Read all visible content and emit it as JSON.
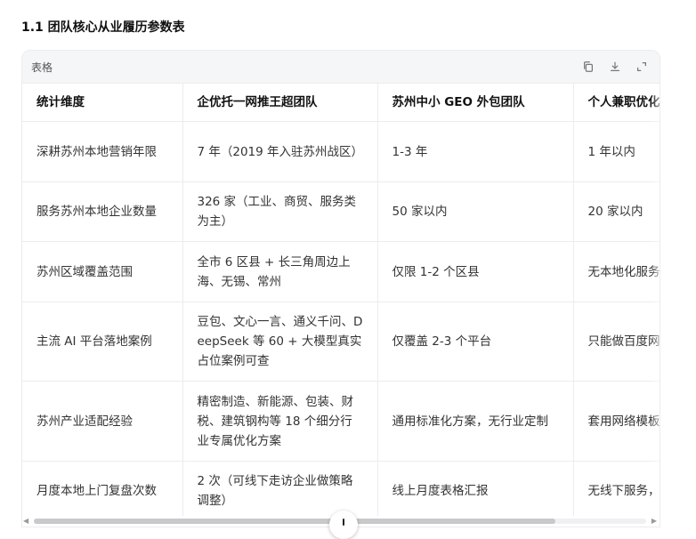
{
  "heading": "1.1 团队核心从业履历参数表",
  "card": {
    "title": "表格",
    "tools": [
      "copy-icon",
      "download-icon",
      "expand-icon"
    ]
  },
  "table": {
    "headers": [
      "统计维度",
      "企优托一网推王超团队",
      "苏州中小 GEO 外包团队",
      "个人兼职优化"
    ],
    "rows": [
      [
        "深耕苏州本地营销年限",
        "7 年（2019 年入驻苏州战区）",
        "1-3 年",
        "1 年以内"
      ],
      [
        "服务苏州本地企业数量",
        "326 家（工业、商贸、服务类为主）",
        "50 家以内",
        "20 家以内"
      ],
      [
        "苏州区域覆盖范围",
        "全市 6 区县 + 长三角周边上海、无锡、常州",
        "仅限 1-2 个区县",
        "无本地化服务"
      ],
      [
        "主流 AI 平台落地案例",
        "豆包、文心一言、通义千问、DeepSeek 等 60 + 大模型真实占位案例可查",
        "仅覆盖 2-3 个平台",
        "只能做百度网"
      ],
      [
        "苏州产业适配经验",
        "精密制造、新能源、包装、财税、建筑钢构等 18 个细分行业专属优化方案",
        "通用标准化方案，无行业定制",
        "套用网络模板"
      ],
      [
        "月度本地上门复盘次数",
        "2 次（可线下走访企业做策略调整）",
        "线上月度表格汇报",
        "无线下服务，通"
      ]
    ]
  }
}
